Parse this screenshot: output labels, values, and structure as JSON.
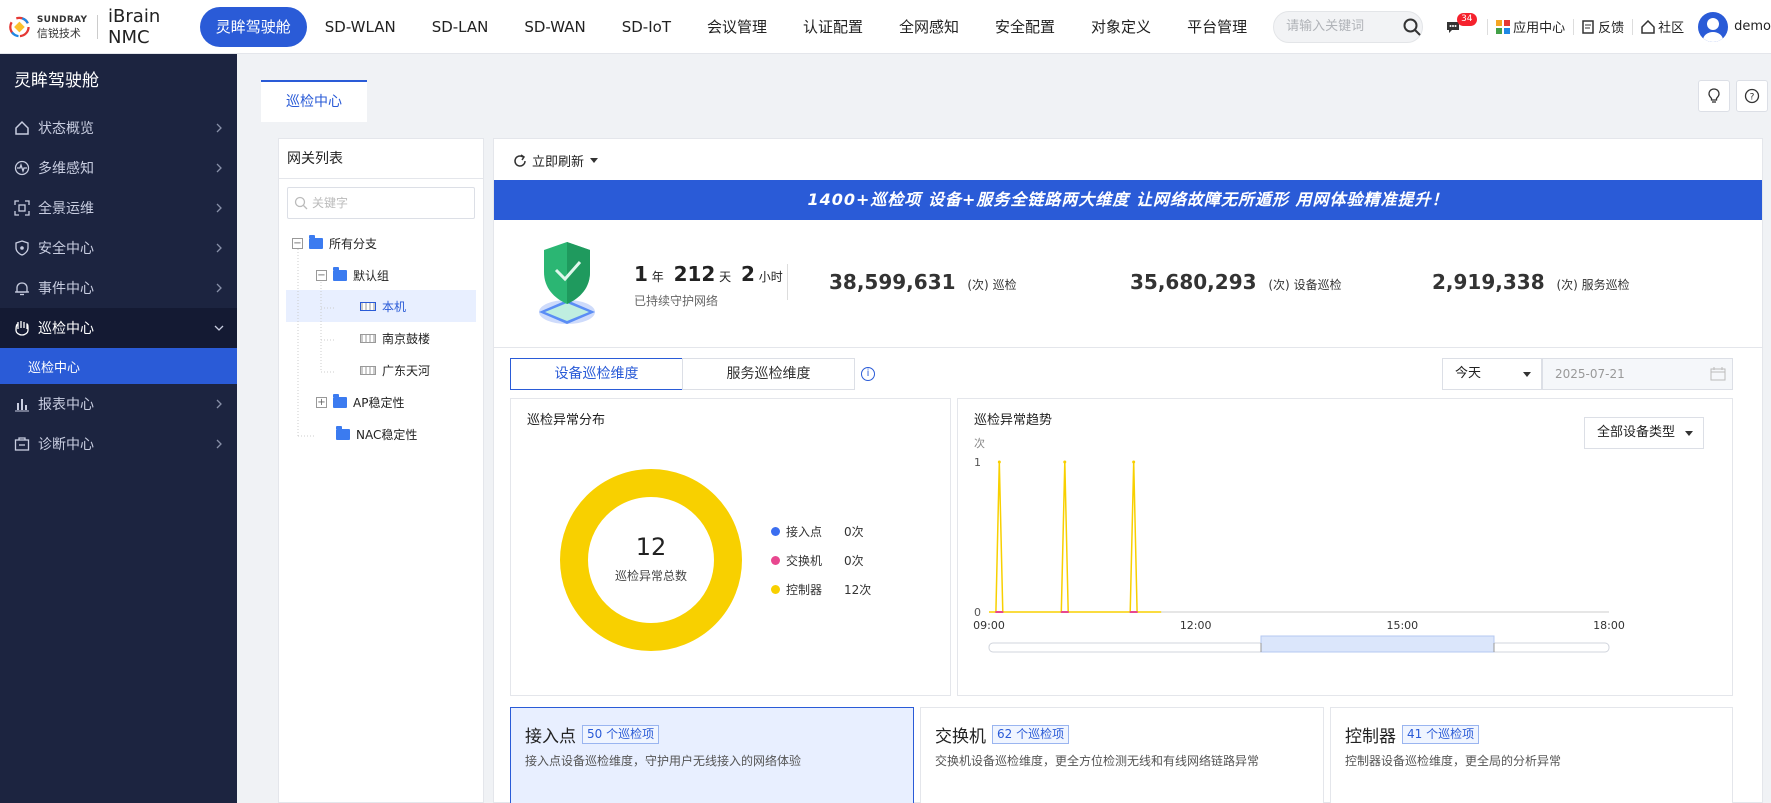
{
  "header": {
    "brand_en": "SUNDRAY",
    "brand_cn": "信锐技术",
    "product": "iBrain NMC",
    "nav": [
      {
        "label": "灵眸驾驶舱",
        "active": true
      },
      {
        "label": "SD-WLAN"
      },
      {
        "label": "SD-LAN"
      },
      {
        "label": "SD-WAN"
      },
      {
        "label": "SD-IoT"
      },
      {
        "label": "会议管理"
      },
      {
        "label": "认证配置"
      },
      {
        "label": "全网感知"
      },
      {
        "label": "安全配置"
      },
      {
        "label": "对象定义"
      },
      {
        "label": "平台管理"
      }
    ],
    "search_placeholder": "请输入关键词",
    "message_count": "34",
    "app_center": "应用中心",
    "feedback": "反馈",
    "community": "社区",
    "user": "demo"
  },
  "sidebar": {
    "title": "灵眸驾驶舱",
    "items": [
      {
        "label": "状态概览",
        "icon": "home-icon"
      },
      {
        "label": "多维感知",
        "icon": "pulse-icon"
      },
      {
        "label": "全景运维",
        "icon": "scan-icon"
      },
      {
        "label": "安全中心",
        "icon": "shield-icon"
      },
      {
        "label": "事件中心",
        "icon": "bell-icon"
      },
      {
        "label": "巡检中心",
        "icon": "hand-icon",
        "open": true
      },
      {
        "label": "报表中心",
        "icon": "bar-chart-icon"
      },
      {
        "label": "诊断中心",
        "icon": "diagnose-icon"
      }
    ],
    "sub_item": "巡检中心"
  },
  "tab": {
    "label": "巡检中心"
  },
  "gateway_panel": {
    "title": "网关列表",
    "search_placeholder": "关键字",
    "tree": [
      {
        "label": "所有分支",
        "type": "folder",
        "toggle": "−"
      },
      {
        "label": "默认组",
        "type": "folder",
        "toggle": "−"
      },
      {
        "label": "本机",
        "type": "device",
        "selected": true
      },
      {
        "label": "南京鼓楼",
        "type": "device"
      },
      {
        "label": "广东天河",
        "type": "device"
      },
      {
        "label": "AP稳定性",
        "type": "folder",
        "toggle": "+"
      },
      {
        "label": "NAC稳定性",
        "type": "folder"
      }
    ]
  },
  "toolbar": {
    "refresh_label": "立即刷新"
  },
  "banner": {
    "text": "1400+巡检项    设备+服务全链路两大维度    让网络故障无所遁形    用网体验精准提升！"
  },
  "stats": {
    "uptime_years": "1",
    "uptime_years_unit": "年",
    "uptime_days": "212",
    "uptime_days_unit": "天",
    "uptime_hours": "2",
    "uptime_hours_unit": "小时",
    "uptime_caption": "已持续守护网络",
    "total": {
      "value": "38,599,631",
      "unit": "(次)",
      "label": "巡检"
    },
    "device": {
      "value": "35,680,293",
      "unit": "(次)",
      "label": "设备巡检"
    },
    "service": {
      "value": "2,919,338",
      "unit": "(次)",
      "label": "服务巡检"
    }
  },
  "dimension_tabs": [
    {
      "label": "设备巡检维度",
      "active": true
    },
    {
      "label": "服务巡检维度"
    }
  ],
  "filters": {
    "period": "今天",
    "date": "2025-07-21",
    "device_type": "全部设备类型"
  },
  "distribution": {
    "title": "巡检异常分布",
    "total": "12",
    "total_label": "巡检异常总数"
  },
  "trend": {
    "title": "巡检异常趋势",
    "y_unit": "次"
  },
  "chart_data": [
    {
      "type": "pie",
      "title": "巡检异常分布",
      "labels": [
        "接入点",
        "交换机",
        "控制器"
      ],
      "values": [
        0,
        0,
        12
      ],
      "value_labels": [
        "0次",
        "0次",
        "12次"
      ],
      "colors": [
        "#3b6ef0",
        "#e8478f",
        "#f8d000"
      ],
      "donut": true,
      "legend": "right"
    },
    {
      "type": "line",
      "title": "巡检异常趋势",
      "ylabel": "次",
      "x_ticks": [
        "09:00",
        "12:00",
        "15:00",
        "18:00"
      ],
      "x_range": [
        9,
        18
      ],
      "ylim": [
        0,
        1
      ],
      "y_ticks": [
        "0",
        "1"
      ],
      "series": [
        {
          "color": "#f8d000",
          "x": [
            9.0,
            9.1,
            9.15,
            9.2,
            9.25,
            10.0,
            10.05,
            10.1,
            10.15,
            10.2,
            11.0,
            11.05,
            11.1,
            11.15,
            11.2,
            11.5
          ],
          "y": [
            0,
            0,
            1,
            0,
            0,
            0,
            0,
            1,
            0,
            0,
            0,
            0,
            1,
            0,
            0,
            0
          ]
        }
      ],
      "grid": false
    }
  ],
  "device_cards": [
    {
      "title": "接入点",
      "tag": "50 个巡检项",
      "desc": "接入点设备巡检维度，守护用户无线接入的网络体验",
      "active": true
    },
    {
      "title": "交换机",
      "tag": "62 个巡检项",
      "desc": "交换机设备巡检维度，更全方位检测无线和有线网络链路异常"
    },
    {
      "title": "控制器",
      "tag": "41 个巡检项",
      "desc": "控制器设备巡检维度，更全局的分析异常"
    }
  ]
}
